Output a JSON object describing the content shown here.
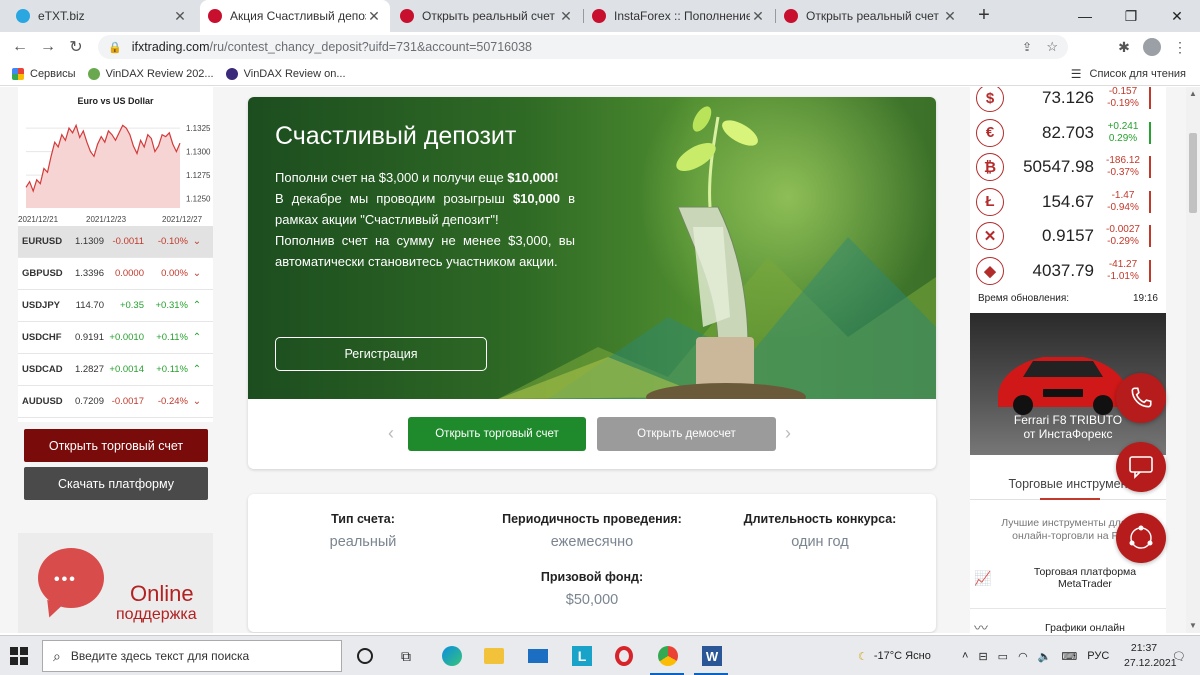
{
  "browser": {
    "tabs": [
      {
        "title": "eTXT.biz",
        "icon": "etxt-favicon",
        "color": "#2aa7e0",
        "active": false
      },
      {
        "title": "Акция Счастливый депозит",
        "icon": "instaforex-favicon",
        "color": "#c8102e",
        "active": true
      },
      {
        "title": "Открыть реальный счет в И",
        "icon": "instaforex-favicon",
        "color": "#c8102e",
        "active": false
      },
      {
        "title": "InstaForex :: Пополнение с",
        "icon": "instaforex-favicon",
        "color": "#c8102e",
        "active": false
      },
      {
        "title": "Открыть реальный счет в И",
        "icon": "instaforex-favicon",
        "color": "#c8102e",
        "active": false
      }
    ],
    "url_host": "ifxtrading.com",
    "url_path": "/ru/contest_chancy_deposit?uifd=731&account=50716038",
    "bookmarks": [
      {
        "label": "Сервисы",
        "icon": "apps-grid-icon"
      },
      {
        "label": "VinDAX Review 202...",
        "icon": "vindax-icon"
      },
      {
        "label": "VinDAX Review on...",
        "icon": "vindax-r-icon"
      }
    ],
    "reading_list": "Список для чтения"
  },
  "left": {
    "chart_title": "Euro vs US Dollar",
    "quotes": [
      {
        "pair": "EURUSD",
        "price": "1.1309",
        "change": "-0.0011",
        "pct": "-0.10%",
        "dir": "down",
        "selected": true
      },
      {
        "pair": "GBPUSD",
        "price": "1.3396",
        "change": "0.0000",
        "pct": "0.00%",
        "dir": "down",
        "selected": false
      },
      {
        "pair": "USDJPY",
        "price": "114.70",
        "change": "+0.35",
        "pct": "+0.31%",
        "dir": "up",
        "selected": false
      },
      {
        "pair": "USDCHF",
        "price": "0.9191",
        "change": "+0.0010",
        "pct": "+0.11%",
        "dir": "up",
        "selected": false
      },
      {
        "pair": "USDCAD",
        "price": "1.2827",
        "change": "+0.0014",
        "pct": "+0.11%",
        "dir": "up",
        "selected": false
      },
      {
        "pair": "AUDUSD",
        "price": "0.7209",
        "change": "-0.0017",
        "pct": "-0.24%",
        "dir": "down",
        "selected": false
      }
    ],
    "open_account": "Открыть торговый счет",
    "download_platform": "Скачать платформу",
    "support_title": "Online",
    "support_sub": "поддержка"
  },
  "chart_data": {
    "type": "area",
    "title": "Euro vs US Dollar",
    "x_ticks": [
      "2021/12/21",
      "2021/12/23",
      "2021/12/27"
    ],
    "y_ticks": [
      "1.1325",
      "1.1300",
      "1.1275",
      "1.1250"
    ],
    "ylim": [
      1.124,
      1.134
    ],
    "series": [
      {
        "values": [
          1.1262,
          1.1268,
          1.1258,
          1.127,
          1.1266,
          1.1282,
          1.1278,
          1.1295,
          1.131,
          1.1305,
          1.1318,
          1.1312,
          1.1325,
          1.132,
          1.1328,
          1.1315,
          1.1322,
          1.131,
          1.13,
          1.1295,
          1.1308,
          1.1316,
          1.131,
          1.1322,
          1.1318,
          1.1312,
          1.132,
          1.1328,
          1.1325,
          1.1318,
          1.1306,
          1.1298,
          1.1312,
          1.1305,
          1.1318,
          1.1314,
          1.13,
          1.1306,
          1.1318,
          1.1316,
          1.132,
          1.1308,
          1.13,
          1.1309
        ]
      }
    ],
    "colors": {
      "line": "#d43a3a",
      "fill": "#f6d4d4"
    },
    "grid": true
  },
  "banner": {
    "title": "Счастливый депозит",
    "p1_a": "Пополни счет на $3,000 и получи еще ",
    "p1_b": "$10,000!",
    "p2_a": "В декабре мы проводим розыгрыш ",
    "p2_b": "$10,000",
    "p2_c": " в рамках акции \"Счастливый депозит\"!",
    "p3": "Пополнив счет на сумму не менее $3,000, вы автоматически становитесь участником акции.",
    "register": "Регистрация",
    "open_account": "Открыть торговый счет",
    "open_demo": "Открыть демосчет"
  },
  "info": {
    "account_type_label": "Тип счета:",
    "account_type_value": "реальный",
    "period_label": "Периодичность проведения:",
    "period_value": "ежемесячно",
    "duration_label": "Длительность конкурса:",
    "duration_value": "один год",
    "prize_label": "Призовой фонд:",
    "prize_value": "$50,000"
  },
  "right": {
    "coins": [
      {
        "icon": "dollar-icon",
        "glyph": "$",
        "price": "73.126",
        "change": "-0.157",
        "pct": "-0.19%",
        "dir": "down"
      },
      {
        "icon": "euro-icon",
        "glyph": "€",
        "price": "82.703",
        "change": "+0.241",
        "pct": "0.29%",
        "dir": "up"
      },
      {
        "icon": "bitcoin-icon",
        "glyph": "₿",
        "price": "50547.98",
        "change": "-186.12",
        "pct": "-0.37%",
        "dir": "down"
      },
      {
        "icon": "litecoin-icon",
        "glyph": "Ł",
        "price": "154.67",
        "change": "-1.47",
        "pct": "-0.94%",
        "dir": "down"
      },
      {
        "icon": "ripple-icon",
        "glyph": "✕",
        "price": "0.9157",
        "change": "-0.0027",
        "pct": "-0.29%",
        "dir": "down"
      },
      {
        "icon": "ethereum-icon",
        "glyph": "◆",
        "price": "4037.79",
        "change": "-41.27",
        "pct": "-1.01%",
        "dir": "down"
      }
    ],
    "update_label": "Время обновления:",
    "update_time": "19:16",
    "ferrari_caption_1": "Ferrari F8 TRIBUTO",
    "ferrari_caption_2": "от ИнстаФорекс",
    "tools_title": "Торговые инструмен",
    "tools_desc_1": "Лучшие инструменты для у",
    "tools_desc_2": "онлайн-торговли на Fo",
    "item1_line1": "Торговая платформа",
    "item1_line2": "MetaTrader",
    "item2": "Графики онлайн"
  },
  "taskbar": {
    "search_placeholder": "Введите здесь текст для поиска",
    "weather": "-17°C Ясно",
    "lang": "РУС",
    "time": "21:37",
    "date": "27.12.2021"
  }
}
